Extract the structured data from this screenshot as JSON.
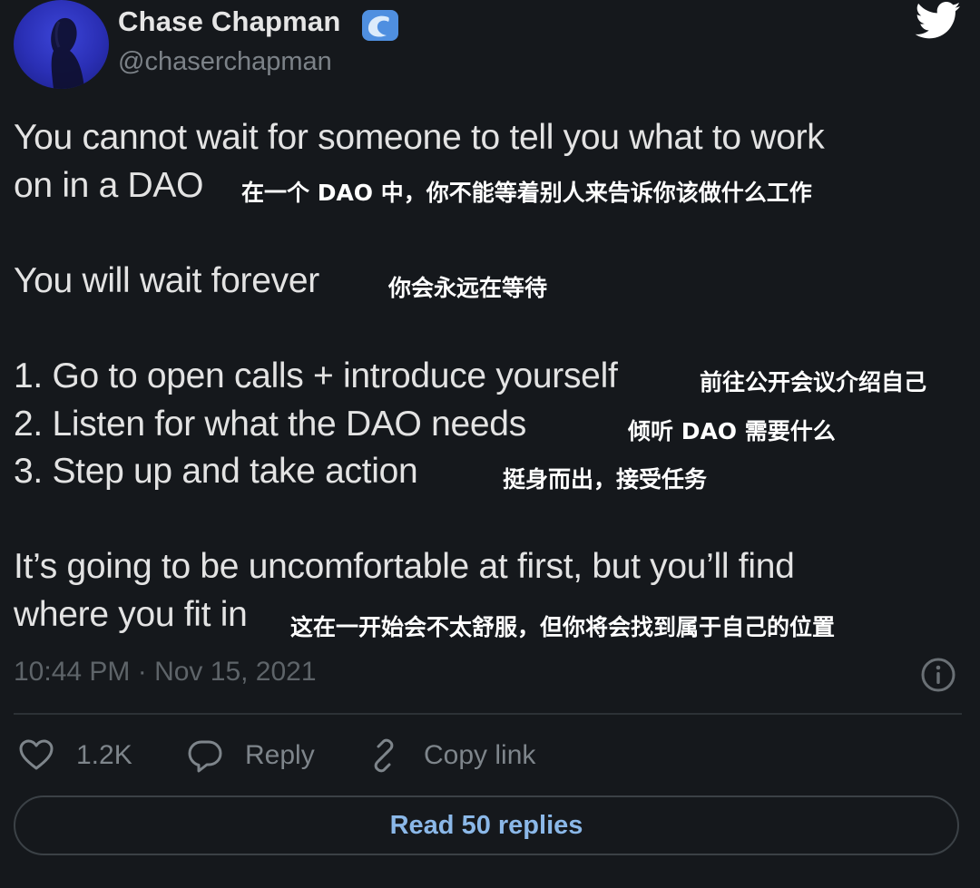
{
  "tweet": {
    "author": {
      "display_name": "Chase Chapman",
      "handle": "@chaserchapman",
      "badge_icon": "wave-icon",
      "avatar_color": "#2a2fb5"
    },
    "platform_icon": "twitter-bird-icon",
    "lines": [
      {
        "en": "You cannot wait for someone to tell you what to work",
        "zh": ""
      },
      {
        "en": "on in a DAO",
        "zh": "在一个 DAO 中，你不能等着别人来告诉你该做什么工作"
      },
      {
        "en": "You will wait forever",
        "zh": "你会永远在等待"
      },
      {
        "en": "1. Go to open calls + introduce yourself",
        "zh": "前往公开会议介绍自己"
      },
      {
        "en": "2. Listen for what the DAO needs",
        "zh": "倾听 DAO 需要什么"
      },
      {
        "en": "3. Step up and take action",
        "zh": "挺身而出，接受任务"
      },
      {
        "en": "It’s going to be uncomfortable at first, but you’ll find",
        "zh": ""
      },
      {
        "en": "where you fit in",
        "zh": "这在一开始会不太舒服，但你将会找到属于自己的位置"
      }
    ],
    "timestamp": "10:44 PM · Nov 15, 2021",
    "info_icon": "info-icon",
    "actions": {
      "like": {
        "icon": "heart-icon",
        "label": "1.2K"
      },
      "reply": {
        "icon": "reply-bubble-icon",
        "label": "Reply"
      },
      "copy_link": {
        "icon": "link-icon",
        "label": "Copy link"
      }
    },
    "read_replies_label": "Read 50 replies",
    "colors": {
      "background": "#15181c",
      "accent": "#8bb8e8",
      "muted": "#7e858b"
    }
  }
}
